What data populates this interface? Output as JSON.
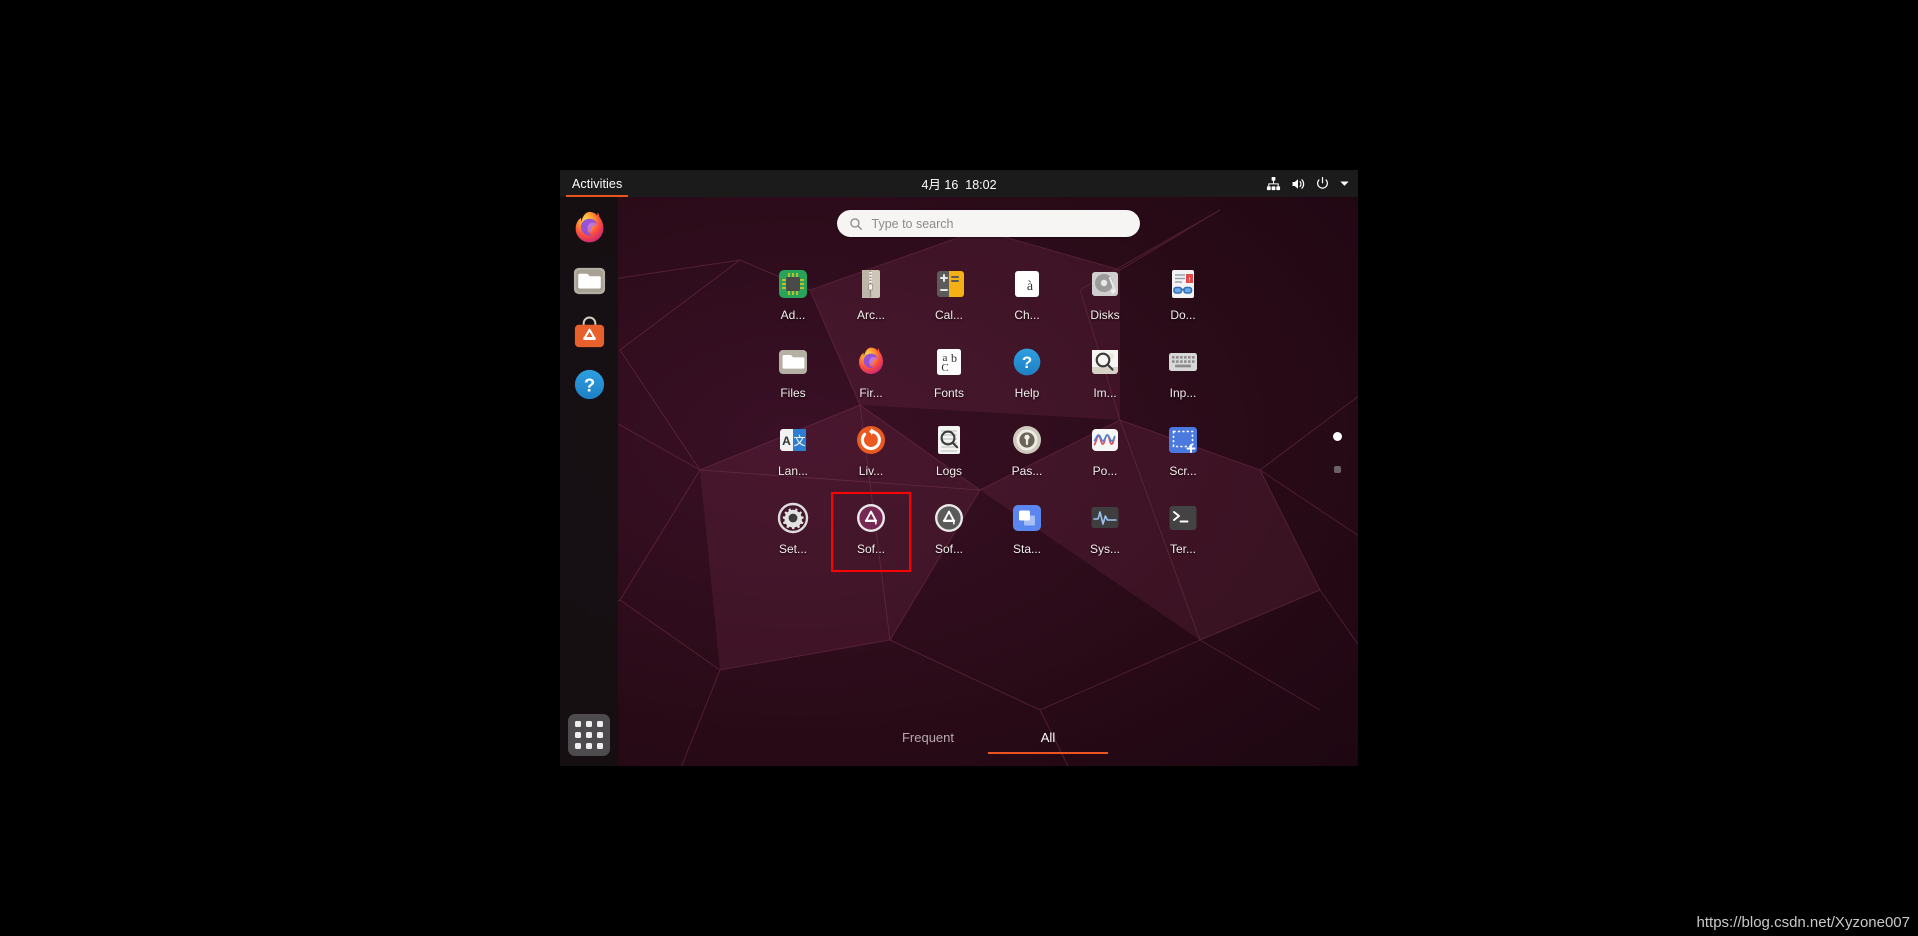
{
  "topbar": {
    "activities_label": "Activities",
    "clock": "4月 16  18:02",
    "icons": [
      {
        "name": "network-icon"
      },
      {
        "name": "volume-icon"
      },
      {
        "name": "power-icon"
      },
      {
        "name": "chevron-down-icon"
      }
    ]
  },
  "dock": {
    "items": [
      {
        "name": "firefox",
        "label": "Firefox"
      },
      {
        "name": "files",
        "label": "Files"
      },
      {
        "name": "ubuntu-software",
        "label": "Ubuntu Software"
      },
      {
        "name": "help",
        "label": "Help"
      }
    ],
    "show_apps_label": "Show Applications"
  },
  "search": {
    "placeholder": "Type to search",
    "value": "",
    "icon": "search-icon"
  },
  "apps": [
    {
      "label": "Ad...",
      "icon": "chip-icon"
    },
    {
      "label": "Arc...",
      "icon": "archive-manager-icon"
    },
    {
      "label": "Cal...",
      "icon": "calculator-icon"
    },
    {
      "label": "Ch...",
      "icon": "characters-icon"
    },
    {
      "label": "Disks",
      "icon": "disks-icon"
    },
    {
      "label": "Do...",
      "icon": "document-viewer-icon"
    },
    {
      "label": "Files",
      "icon": "files-icon"
    },
    {
      "label": "Fir...",
      "icon": "firefox-icon"
    },
    {
      "label": "Fonts",
      "icon": "fonts-icon"
    },
    {
      "label": "Help",
      "icon": "help-icon"
    },
    {
      "label": "Im...",
      "icon": "image-viewer-icon"
    },
    {
      "label": "Inp...",
      "icon": "input-keyboard-icon"
    },
    {
      "label": "Lan...",
      "icon": "language-selector-icon"
    },
    {
      "label": "Liv...",
      "icon": "livepatch-icon"
    },
    {
      "label": "Logs",
      "icon": "logs-icon"
    },
    {
      "label": "Pas...",
      "icon": "passwords-keys-icon"
    },
    {
      "label": "Po...",
      "icon": "power-statistics-icon"
    },
    {
      "label": "Scr...",
      "icon": "screenshot-icon"
    },
    {
      "label": "Set...",
      "icon": "settings-gear-icon"
    },
    {
      "label": "Sof...",
      "icon": "ubuntu-software-icon",
      "highlighted": true
    },
    {
      "label": "Sof...",
      "icon": "software-updater-icon"
    },
    {
      "label": "Sta...",
      "icon": "startup-applications-icon"
    },
    {
      "label": "Sys...",
      "icon": "system-monitor-icon"
    },
    {
      "label": "Ter...",
      "icon": "terminal-icon"
    }
  ],
  "page_indicator": {
    "pages": 2,
    "current": 1
  },
  "tabs": [
    {
      "label": "Frequent",
      "active": false
    },
    {
      "label": "All",
      "active": true
    }
  ],
  "watermark": "https://blog.csdn.net/Xyzone007",
  "colors": {
    "accent": "#e95420",
    "highlight_box": "#ff0000",
    "topbar_bg": "#1b1b1b",
    "dock_bg": "#141012",
    "wallpaper_bg": "#2c0b18"
  }
}
